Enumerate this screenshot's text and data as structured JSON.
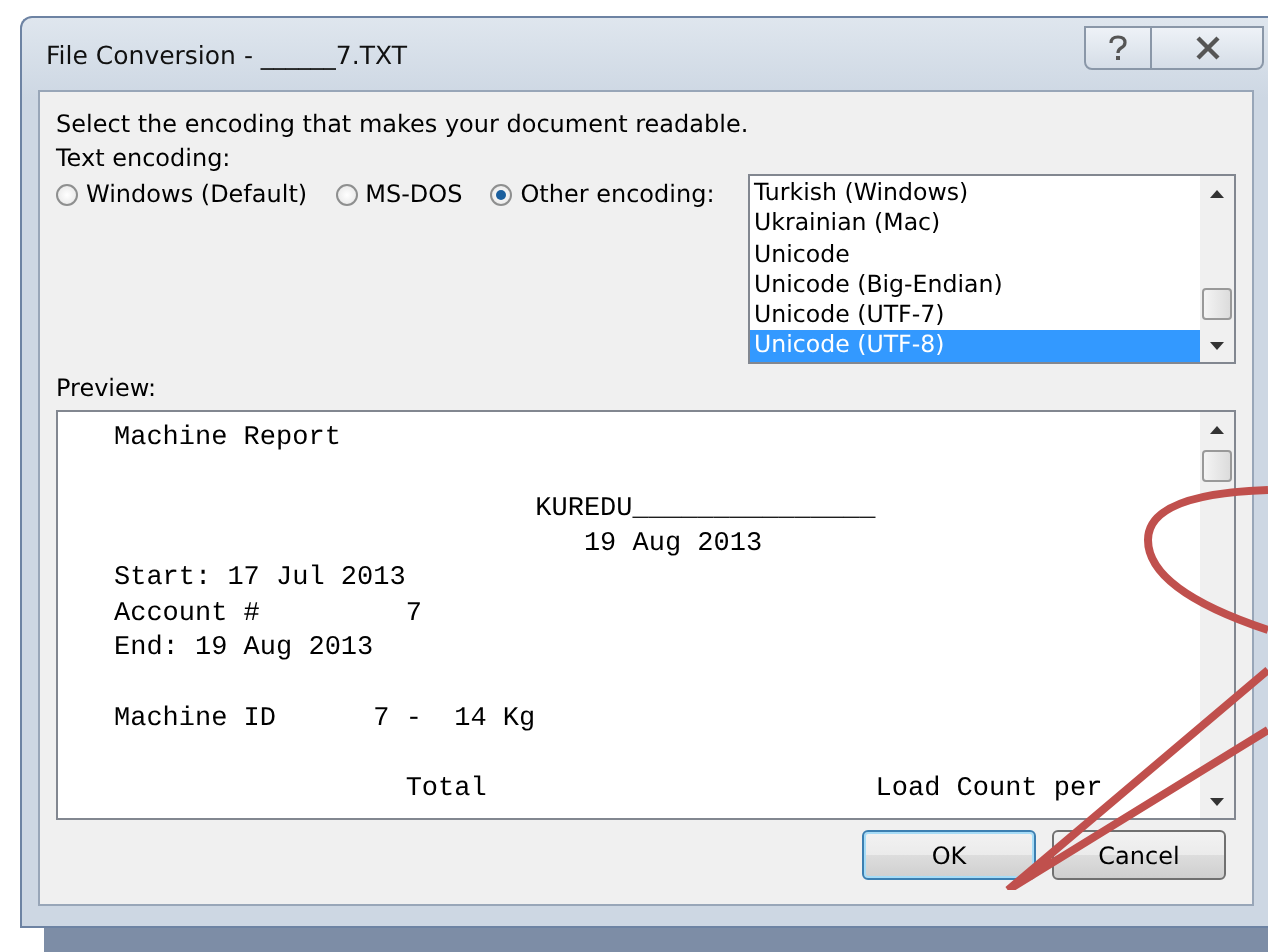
{
  "window": {
    "title": "File Conversion - ______7.TXT"
  },
  "instruction": "Select the encoding that makes your document readable.",
  "encoding_label": "Text encoding:",
  "encodings": [
    {
      "label": "Windows (Default)",
      "selected": false
    },
    {
      "label": "MS-DOS",
      "selected": false
    },
    {
      "label": "Other encoding:",
      "selected": true
    }
  ],
  "encoding_list": [
    {
      "label": "Turkish (Windows)",
      "selected": false
    },
    {
      "label": "Ukrainian (Mac)",
      "selected": false
    },
    {
      "label": "Unicode",
      "selected": false
    },
    {
      "label": "Unicode (Big-Endian)",
      "selected": false
    },
    {
      "label": "Unicode (UTF-7)",
      "selected": false
    },
    {
      "label": "Unicode (UTF-8)",
      "selected": true
    }
  ],
  "preview_label": "Preview:",
  "preview_lines": [
    {
      "text": "Machine Report",
      "blank_before": false
    },
    {
      "text": "                          KUREDU_______________",
      "blank_before": true
    },
    {
      "text": "                             19 Aug 2013",
      "blank_before": false
    },
    {
      "text": "Start: 17 Jul 2013",
      "blank_before": false
    },
    {
      "text": "Account #         7",
      "blank_before": false
    },
    {
      "text": "End: 19 Aug 2013",
      "blank_before": false
    },
    {
      "text": "Machine ID      7 -  14 Kg",
      "blank_before": true
    },
    {
      "text": "                  Total                        Load Count per",
      "blank_before": true
    }
  ],
  "buttons": [
    {
      "label": "OK",
      "focused": true
    },
    {
      "label": "Cancel",
      "focused": false
    }
  ]
}
